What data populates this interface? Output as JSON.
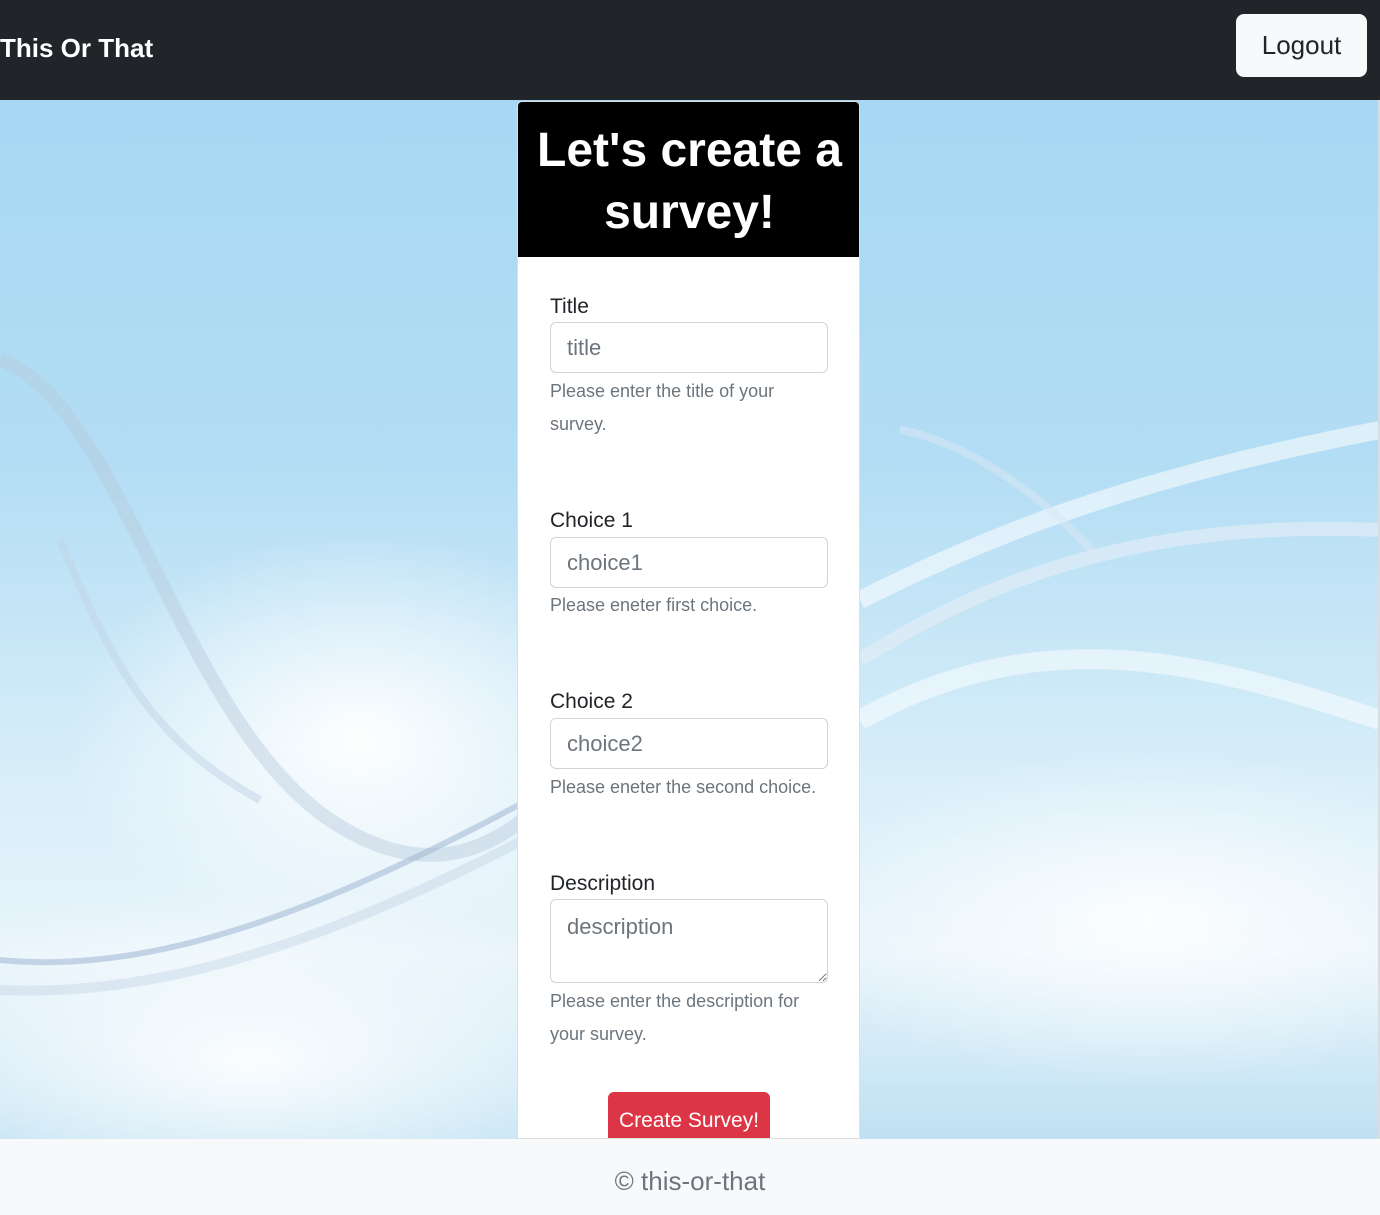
{
  "navbar": {
    "brand": "This Or That",
    "logout_label": "Logout"
  },
  "card": {
    "heading": "Let's create a survey!"
  },
  "form": {
    "title": {
      "label": "Title",
      "placeholder": "title",
      "help": "Please enter the title of your survey."
    },
    "choice1": {
      "label": "Choice 1",
      "placeholder": "choice1",
      "help": "Please eneter first choice."
    },
    "choice2": {
      "label": "Choice 2",
      "placeholder": "choice2",
      "help": "Please eneter the second choice."
    },
    "description": {
      "label": "Description",
      "placeholder": "description",
      "help": "Please enter the description for your survey."
    },
    "submit_label": "Create Survey!"
  },
  "footer": {
    "text": "© this-or-that"
  },
  "colors": {
    "navbar": "#212529",
    "card_header": "#000000",
    "submit": "#dc3545",
    "footer": "#f8f9fa"
  }
}
